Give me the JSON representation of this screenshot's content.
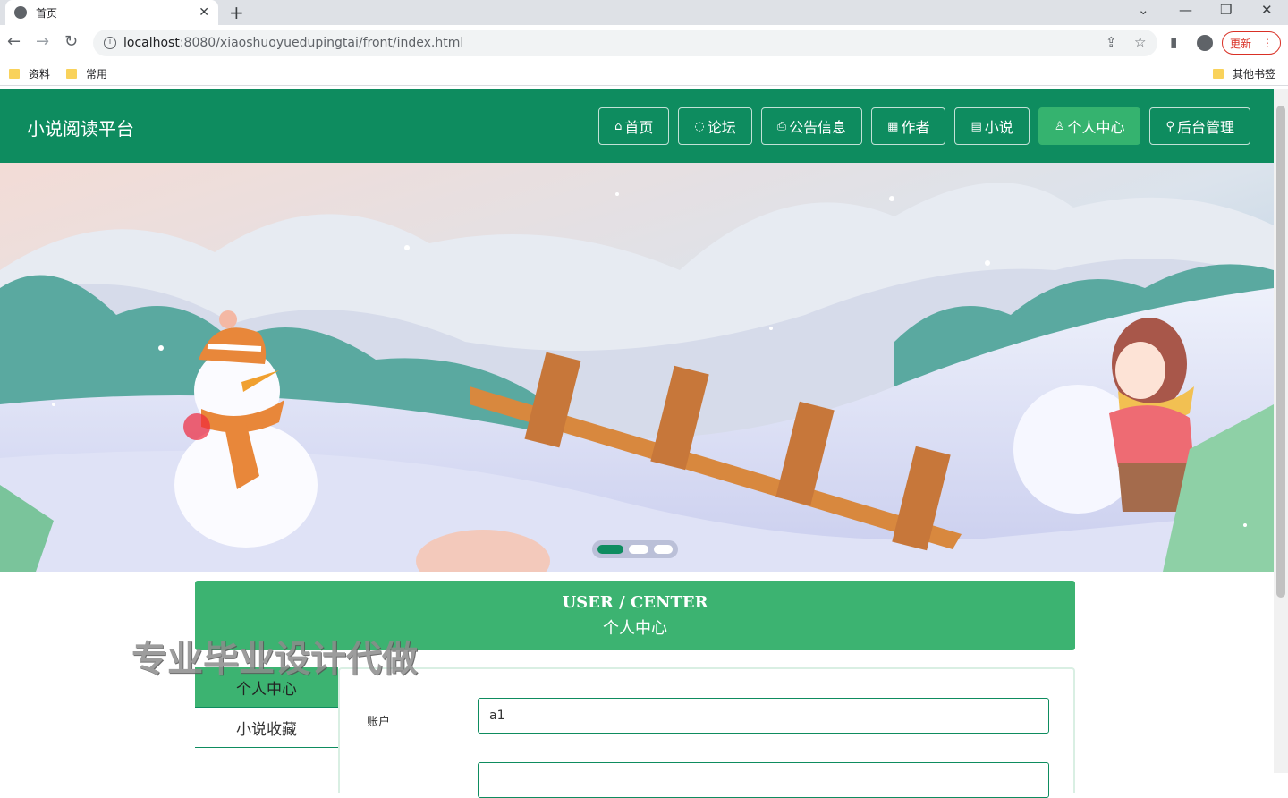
{
  "browser": {
    "tab_title": "首页",
    "tab_close": "✕",
    "new_tab": "+",
    "url_host": "localhost",
    "url_rest": ":8080/xiaoshuoyuedupingtai/front/index.html",
    "update_label": "更新",
    "window_controls": [
      "⌄",
      "—",
      "❐",
      "✕"
    ],
    "bookmarks": [
      "资料",
      "常用"
    ],
    "other_bookmarks": "其他书签"
  },
  "site": {
    "title": "小说阅读平台",
    "nav": [
      {
        "icon": "⌂",
        "label": "首页"
      },
      {
        "icon": "◌",
        "label": "论坛"
      },
      {
        "icon": "⎙",
        "label": "公告信息"
      },
      {
        "icon": "▦",
        "label": "作者"
      },
      {
        "icon": "▤",
        "label": "小说"
      },
      {
        "icon": "♙",
        "label": "个人中心"
      },
      {
        "icon": "⚲",
        "label": "后台管理"
      }
    ],
    "active_nav_index": 5
  },
  "user_center": {
    "title_en": "USER / CENTER",
    "title_cn": "个人中心",
    "menu": [
      "个人中心",
      "小说收藏"
    ],
    "fields": [
      {
        "label": "账户",
        "value": "a1"
      },
      {
        "label": "",
        "value": ""
      }
    ]
  },
  "watermark": "专业毕业设计代做",
  "colors": {
    "brand_green": "#0e8c5f",
    "accent_green": "#3cb371"
  }
}
